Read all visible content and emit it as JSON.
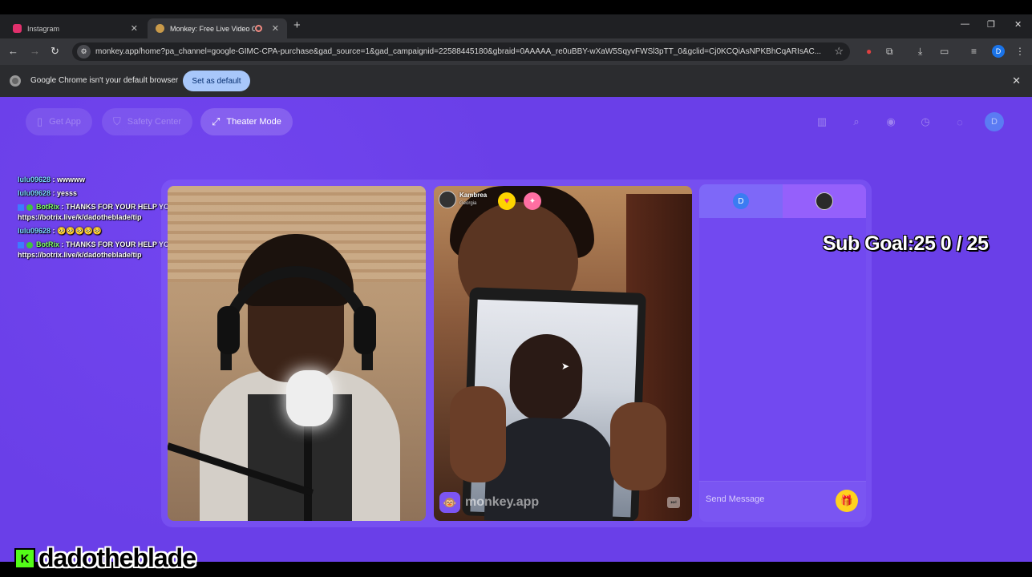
{
  "browser": {
    "tabs": [
      {
        "title": "Instagram",
        "favicon_color": "#e1306c"
      },
      {
        "title": "Monkey: Free Live Video Ch",
        "favicon_color": "#c99a4a",
        "active": true
      }
    ],
    "url": "monkey.app/home?pa_channel=google-GIMC-CPA-purchase&gad_source=1&gad_campaignid=22588445180&gbraid=0AAAAA_re0uBBY-wXaW5SqyvFWSl3pTT_0&gclid=Cj0KCQiAsNPKBhCqARIsAC...",
    "profile_initial": "D",
    "infobar_message": "Google Chrome isn't your default browser",
    "set_default_label": "Set as default"
  },
  "nav": {
    "get_app": "Get App",
    "safety_center": "Safety Center",
    "theater_mode": "Theater Mode",
    "avatar_initial": "D"
  },
  "chat_overlay": [
    {
      "user": "lulu09628",
      "text": " : wwwww",
      "type": "user"
    },
    {
      "user": "lulu09628",
      "text": " : yesss",
      "type": "user"
    },
    {
      "user": "BotRix",
      "text": " : THANKS FOR YOUR HELP YOU CAN DONATE HERE https://botrix.live/k/dadotheblade/tip",
      "type": "bot"
    },
    {
      "user": "lulu09628",
      "text": " : 🥺🥺🥺🥺🥺",
      "type": "user"
    },
    {
      "user": "BotRix",
      "text": " : THANKS FOR YOUR HELP YOU CAN DONATE HERE https://botrix.live/k/dadotheblade/tip",
      "type": "bot"
    }
  ],
  "call": {
    "partner_name": "Kambrea",
    "partner_location": "Georgia",
    "watermark": "monkey.app"
  },
  "panel": {
    "tab_a_initial": "D",
    "message_placeholder": "Send Message"
  },
  "overlay": {
    "sub_goal": "Sub Goal:25  0 / 25",
    "streamer_handle": "dadotheblade",
    "platform_badge": "K"
  },
  "colors": {
    "page_bg": "#6a3fe8",
    "accent_yellow": "#ffd21e",
    "kick_green": "#53fc18"
  }
}
